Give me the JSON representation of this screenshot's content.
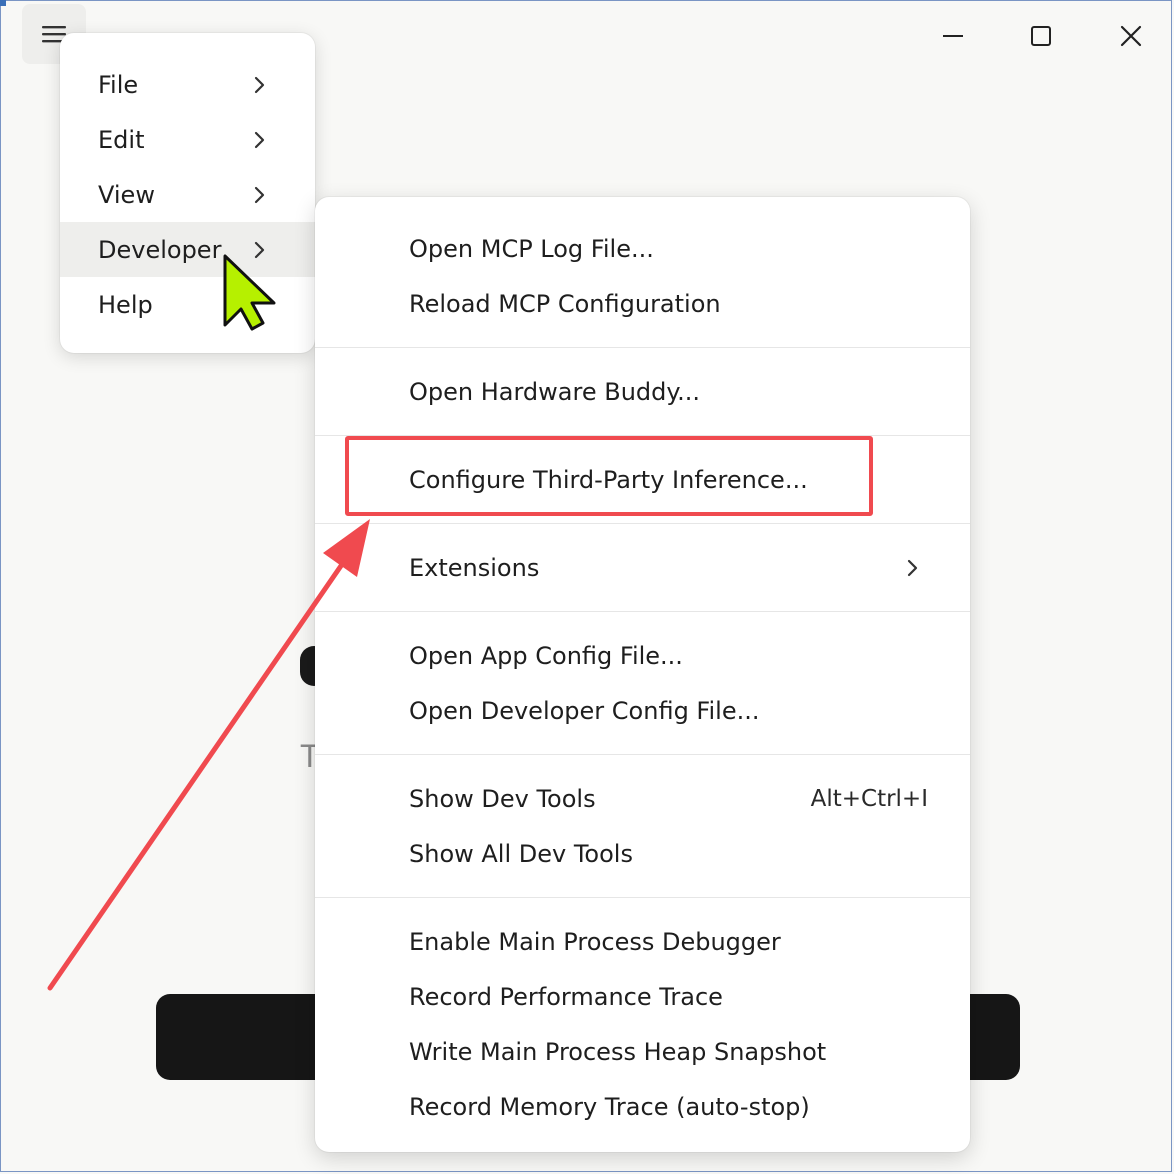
{
  "title_bar": {
    "menu_icon": "hamburger-menu-icon",
    "minimize_icon": "minimize-icon",
    "maximize_icon": "maximize-icon",
    "close_icon": "close-icon"
  },
  "background": {
    "partial_text": "T"
  },
  "main_menu": {
    "items": [
      {
        "label": "File",
        "has_submenu": true
      },
      {
        "label": "Edit",
        "has_submenu": true
      },
      {
        "label": "View",
        "has_submenu": true
      },
      {
        "label": "Developer",
        "has_submenu": true,
        "active": true
      },
      {
        "label": "Help",
        "has_submenu": false
      }
    ]
  },
  "developer_menu": {
    "groups": [
      [
        {
          "label": "Open MCP Log File..."
        },
        {
          "label": "Reload MCP Configuration"
        }
      ],
      [
        {
          "label": "Open Hardware Buddy..."
        }
      ],
      [
        {
          "label": "Configure Third-Party Inference...",
          "highlighted": true
        }
      ],
      [
        {
          "label": "Extensions",
          "has_submenu": true
        }
      ],
      [
        {
          "label": "Open App Config File..."
        },
        {
          "label": "Open Developer Config File..."
        }
      ],
      [
        {
          "label": "Show Dev Tools",
          "shortcut": "Alt+Ctrl+I"
        },
        {
          "label": "Show All Dev Tools"
        }
      ],
      [
        {
          "label": "Enable Main Process Debugger"
        },
        {
          "label": "Record Performance Trace"
        },
        {
          "label": "Write Main Process Heap Snapshot"
        },
        {
          "label": "Record Memory Trace (auto-stop)"
        }
      ]
    ]
  },
  "annotation": {
    "highlight_color": "#f04a4f",
    "cursor_color": "#b6f000"
  }
}
